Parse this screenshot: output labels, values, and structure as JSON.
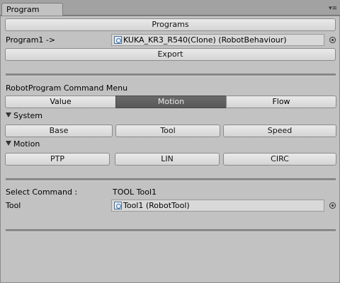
{
  "window": {
    "tab_title": "Program"
  },
  "programs_button": "Programs",
  "program_field": {
    "label": "Program1 ->",
    "value": "KUKA_KR3_R540(Clone) (RobotBehaviour)"
  },
  "export_button": "Export",
  "command_menu": {
    "title": "RobotProgram Command Menu",
    "tabs": [
      {
        "label": "Value"
      },
      {
        "label": "Motion",
        "active": true
      },
      {
        "label": "Flow"
      }
    ]
  },
  "system_section": {
    "title": "System",
    "buttons": [
      "Base",
      "Tool",
      "Speed"
    ]
  },
  "motion_section": {
    "title": "Motion",
    "buttons": [
      "PTP",
      "LIN",
      "CIRC"
    ]
  },
  "select_command": {
    "label": "Select Command :",
    "value": "TOOL Tool1"
  },
  "tool_field": {
    "label": "Tool",
    "value": "Tool1 (RobotTool)"
  },
  "icons": {
    "object_field": "script-object-icon",
    "object_picker": "object-picker-icon",
    "panel_menu": "panel-menu-icon",
    "foldout": "foldout-triangle-icon"
  },
  "colors": {
    "panel_bg": "#c2c2c2",
    "window_bg": "#a2a2a2",
    "active_tab_bg": "#606060",
    "button_bg": "#e0e0e0"
  }
}
